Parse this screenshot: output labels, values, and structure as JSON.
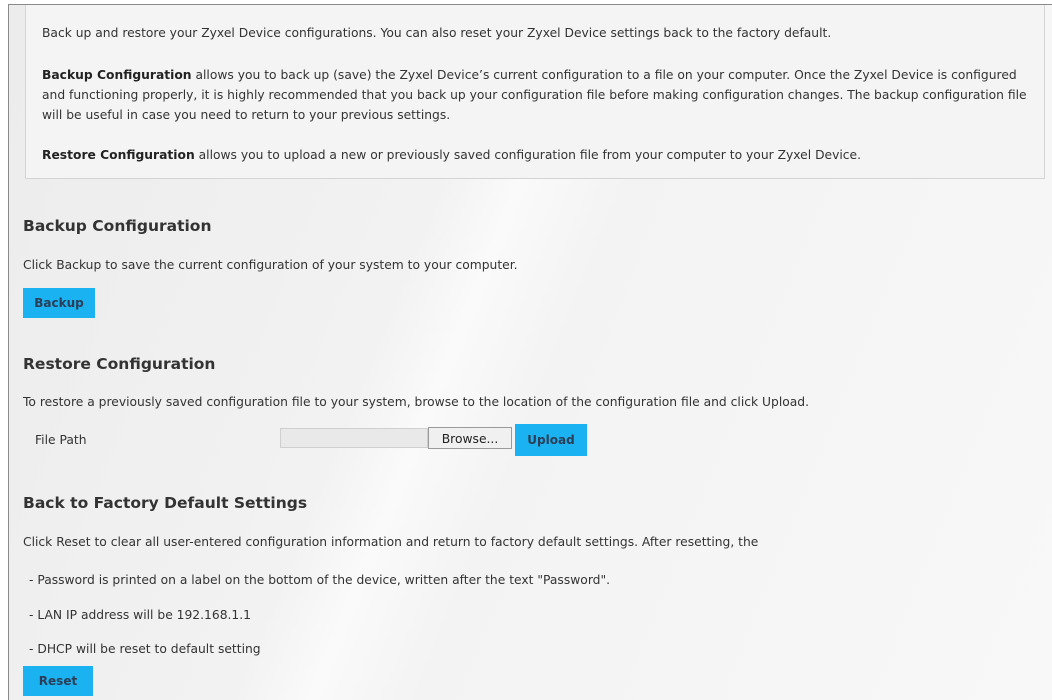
{
  "intro": {
    "line1": "Back up and restore your Zyxel Device configurations. You can also reset your Zyxel Device settings back to the factory default.",
    "backup_bold": "Backup Configuration",
    "backup_text": " allows you to back up (save) the Zyxel Device’s current configuration to a file on your computer. Once the Zyxel Device is configured and functioning properly, it is highly recommended that you back up your configuration file before making configuration changes. The backup configuration file will be useful in case you need to return to your previous settings.",
    "restore_bold": "Restore Configuration",
    "restore_text": " allows you to upload a new or previously saved configuration file from your computer to your Zyxel Device."
  },
  "backup": {
    "title": "Backup Configuration",
    "description": "Click Backup to save the current configuration of your system to your computer.",
    "button_label": "Backup"
  },
  "restore": {
    "title": "Restore Configuration",
    "description": "To restore a previously saved configuration file to your system, browse to the location of the configuration file and click Upload.",
    "file_path_label": "File Path",
    "file_path_value": "",
    "browse_label": "Browse...",
    "upload_label": "Upload"
  },
  "factory": {
    "title": "Back to Factory Default Settings",
    "description": "Click Reset to clear all user-entered configuration information and return to factory default settings. After resetting, the",
    "items": [
      "- Password is printed on a label on the bottom of the device, written after the text \"Password\".",
      "- LAN IP address will be 192.168.1.1",
      "- DHCP will be reset to default setting"
    ],
    "reset_label": "Reset"
  },
  "colors": {
    "button_bg": "#1ab2f0",
    "button_text": "#2c3e57"
  }
}
